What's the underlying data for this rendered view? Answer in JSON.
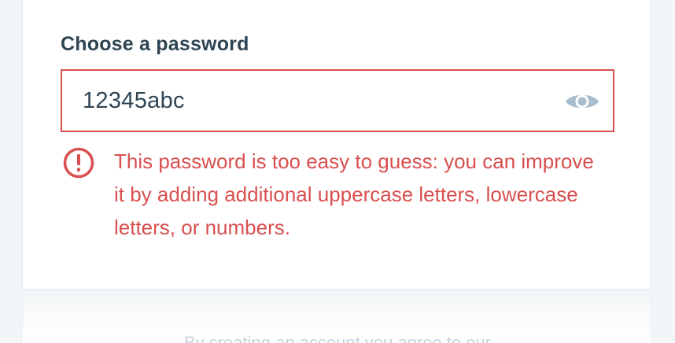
{
  "password_field": {
    "label": "Choose a password",
    "value": "12345abc",
    "show_password_icon": "eye-icon",
    "error_message": "This password is too easy to guess: you can improve it by adding additional uppercase letters, lowercase letters, or numbers.",
    "error_icon": "exclamation-circle-icon"
  },
  "footer": {
    "terms_text": "By creating an account you agree to our"
  },
  "colors": {
    "label": "#2e4453",
    "error": "#d94f4f",
    "icon_muted": "#a8bece",
    "background": "#f3f6f8"
  }
}
